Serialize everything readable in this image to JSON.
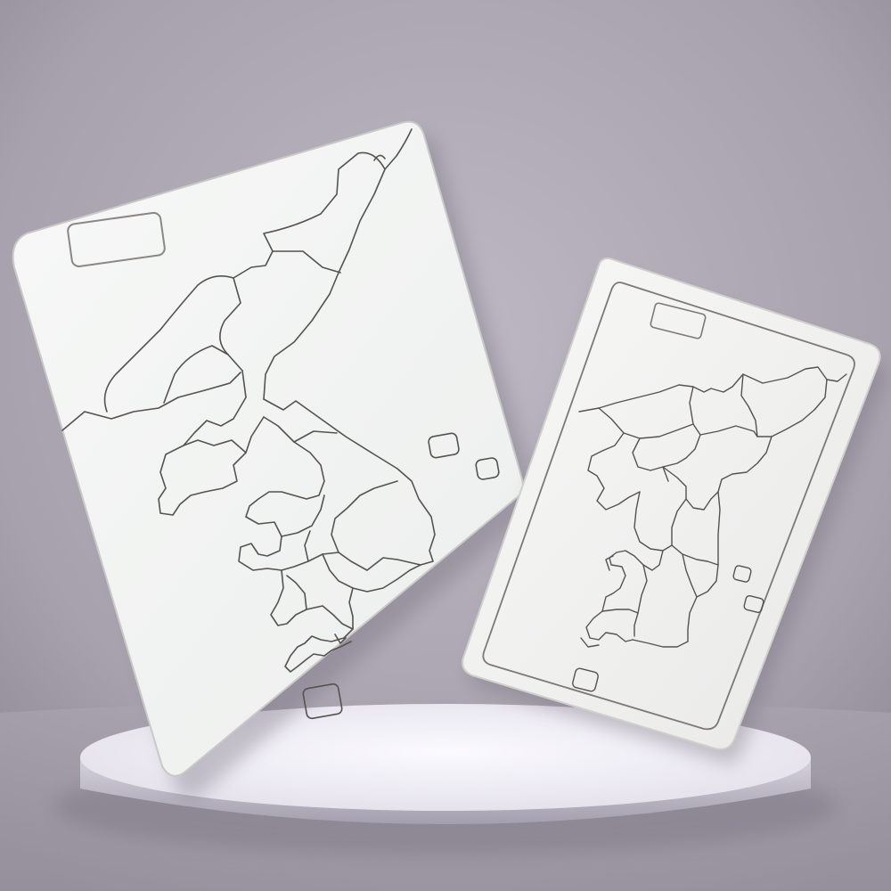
{
  "scene": {
    "title": "",
    "colors": {
      "wall_light": "#b6b1bd",
      "wall_dark": "#8d8794",
      "pedestal_top": "#efedf5",
      "pedestal_side": "#b3afbe",
      "board_face": "#f5f6f5",
      "board_edge": "#d9d9d6",
      "cut_line": "#55524f"
    },
    "objects": [
      {
        "name": "large-puzzle-board",
        "kind": "blank outline map puzzle board",
        "pieces_visible": true
      },
      {
        "name": "small-puzzle-board",
        "kind": "blank outline map puzzle board with border frame",
        "pieces_visible": true
      },
      {
        "name": "round-pedestal",
        "kind": "display stand"
      }
    ]
  }
}
